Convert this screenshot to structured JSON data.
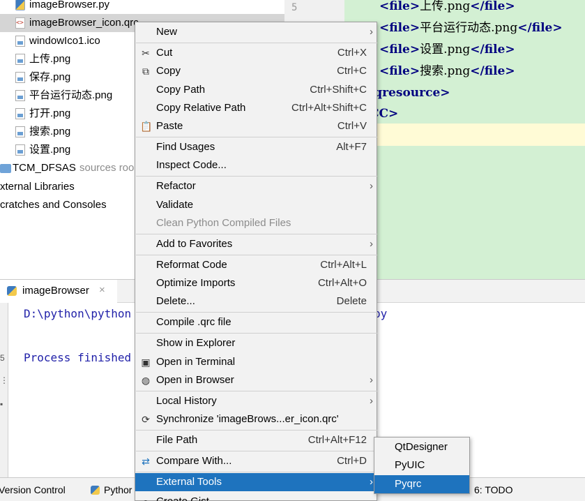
{
  "project_tree": {
    "items": [
      {
        "label": "imageBrowser.py",
        "icon": "python-file-icon"
      },
      {
        "label": "imageBrowser_icon.qrc",
        "icon": "qrc-file-icon"
      },
      {
        "label": "windowIco1.ico",
        "icon": "image-file-icon"
      },
      {
        "label": "上传.png",
        "icon": "image-file-icon"
      },
      {
        "label": "保存.png",
        "icon": "image-file-icon"
      },
      {
        "label": "平台运行动态.png",
        "icon": "image-file-icon"
      },
      {
        "label": "打开.png",
        "icon": "image-file-icon"
      },
      {
        "label": "搜索.png",
        "icon": "image-file-icon"
      },
      {
        "label": "设置.png",
        "icon": "image-file-icon"
      },
      {
        "label": "TCM_DFSAS",
        "suffix": "sources roo",
        "icon": "folder-icon"
      },
      {
        "label": "xternal Libraries"
      },
      {
        "label": "cratches and Consoles"
      }
    ]
  },
  "editor": {
    "gutter_number": "5",
    "lines": [
      {
        "open": "<file>",
        "text": "上传.png",
        "close": "</file>"
      },
      {
        "open": "<file>",
        "text": "平台运行动态.png",
        "close": "</file>"
      },
      {
        "open": "<file>",
        "text": "设置.png",
        "close": "</file>"
      },
      {
        "open": "<file>",
        "text": "搜索.png",
        "close": "</file>"
      },
      {
        "open": "/qresource>",
        "text": "",
        "close": ""
      },
      {
        "open": "CC>",
        "text": "",
        "close": ""
      }
    ]
  },
  "run_panel": {
    "tab_label": "imageBrowser",
    "close_glyph": "×",
    "side_marks": [
      "5",
      "⋮",
      "▪"
    ],
    "console_lines": [
      {
        "left": "D:\\python\\python",
        "right": "py"
      },
      {
        "left": "Process finished",
        "right": ""
      }
    ]
  },
  "tool_window_bar": {
    "version_control": "Version Control",
    "python": "Pythor",
    "todo": "6: TODO"
  },
  "context_menu": {
    "items": [
      {
        "label": "New",
        "shortcut": "",
        "submenu": true
      },
      {
        "label": "Cut",
        "shortcut": "Ctrl+X",
        "icon": "scissors-icon"
      },
      {
        "label": "Copy",
        "shortcut": "Ctrl+C",
        "icon": "copy-icon"
      },
      {
        "label": "Copy Path",
        "shortcut": "Ctrl+Shift+C"
      },
      {
        "label": "Copy Relative Path",
        "shortcut": "Ctrl+Alt+Shift+C"
      },
      {
        "label": "Paste",
        "shortcut": "Ctrl+V",
        "icon": "paste-icon"
      },
      {
        "label": "Find Usages",
        "shortcut": "Alt+F7"
      },
      {
        "label": "Inspect Code...",
        "shortcut": ""
      },
      {
        "label": "Refactor",
        "shortcut": "",
        "submenu": true
      },
      {
        "label": "Validate",
        "shortcut": ""
      },
      {
        "label": "Clean Python Compiled Files",
        "shortcut": "",
        "disabled": true
      },
      {
        "label": "Add to Favorites",
        "shortcut": "",
        "submenu": true
      },
      {
        "label": "Reformat Code",
        "shortcut": "Ctrl+Alt+L"
      },
      {
        "label": "Optimize Imports",
        "shortcut": "Ctrl+Alt+O"
      },
      {
        "label": "Delete...",
        "shortcut": "Delete"
      },
      {
        "label": "Compile .qrc file",
        "shortcut": ""
      },
      {
        "label": "Show in Explorer",
        "shortcut": ""
      },
      {
        "label": "Open in Terminal",
        "shortcut": "",
        "icon": "terminal-icon"
      },
      {
        "label": "Open in Browser",
        "shortcut": "",
        "submenu": true,
        "icon": "globe-icon"
      },
      {
        "label": "Local History",
        "shortcut": "",
        "submenu": true
      },
      {
        "label": "Synchronize 'imageBrows...er_icon.qrc'",
        "shortcut": "",
        "icon": "sync-icon"
      },
      {
        "label": "File Path",
        "shortcut": "Ctrl+Alt+F12"
      },
      {
        "label": "Compare With...",
        "shortcut": "Ctrl+D",
        "icon": "compare-icon"
      },
      {
        "label": "External Tools",
        "shortcut": "",
        "submenu": true,
        "active": true
      },
      {
        "label": "Create Gist...",
        "shortcut": "",
        "icon": "github-icon"
      }
    ],
    "arrow_glyph": "›"
  },
  "external_tools_submenu": {
    "items": [
      {
        "label": "QtDesigner"
      },
      {
        "label": "PyUIC"
      },
      {
        "label": "Pyqrc",
        "active": true
      }
    ]
  },
  "colors": {
    "selection": "#1e73be",
    "editor_highlight": "#d3f0d3",
    "caret_row": "#fffbd6",
    "xml_tag": "#000080",
    "console_text": "#1f1fa8"
  }
}
